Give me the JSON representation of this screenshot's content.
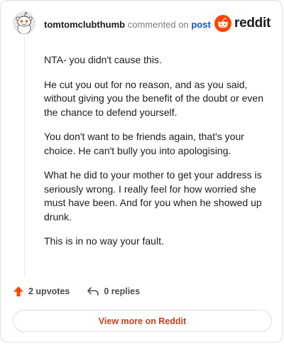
{
  "header": {
    "username": "tomtomclubthumb",
    "action_text": "commented on",
    "post_link": "post"
  },
  "logo": {
    "text": "reddit",
    "color": "#ff4500"
  },
  "comment": {
    "paragraphs": [
      "NTA- you didn't cause this.",
      "He cut you out for no reason, and as you said, without giving you the benefit of the doubt or even the chance to defend yourself.",
      "You don't want to be friends again, that's your choice. He can't bully you into apologising.",
      "What he did to your mother to get your address is seriously wrong. I really feel for how worried she must have been. And for you when he showed up drunk.",
      "This is in no way your fault."
    ]
  },
  "actions": {
    "upvotes": "2 upvotes",
    "replies": "0 replies"
  },
  "footer": {
    "view_more": "View more on Reddit"
  },
  "colors": {
    "accent": "#ff4500",
    "link": "#0b59b5",
    "view_more": "#c2411d"
  },
  "icons": {
    "avatar": "snoo-avatar",
    "logo": "reddit-snoo-icon",
    "upvote": "upvote-arrow-icon",
    "reply": "reply-arrow-icon"
  }
}
